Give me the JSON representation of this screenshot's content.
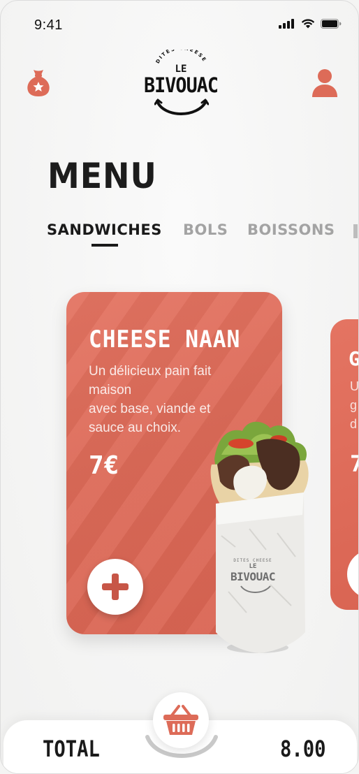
{
  "status_bar": {
    "time": "9:41"
  },
  "header": {
    "logo": {
      "tagline": "DITES CHEESE",
      "prefix": "LE",
      "name": "BIVOUAC"
    }
  },
  "page_title": "MENU",
  "tabs": [
    {
      "label": "SANDWICHES",
      "active": true
    },
    {
      "label": "BOLS",
      "active": false
    },
    {
      "label": "BOISSONS",
      "active": false
    }
  ],
  "products": [
    {
      "name": "CHEESE NAAN",
      "description_lines": [
        "Un délicieux pain fait",
        "maison",
        "avec base, viande et",
        "sauce au choix."
      ],
      "price": "7€",
      "image_brand": {
        "tagline": "DITES CHEESE",
        "prefix": "LE",
        "name": "BIVOUAC"
      }
    },
    {
      "name": "G",
      "description_lines": [
        "U",
        "g",
        "d"
      ],
      "price": "7"
    }
  ],
  "cart": {
    "total_label": "TOTAL",
    "total_value": "8.00"
  },
  "colors": {
    "accent": "#dd6b58",
    "text": "#1a1a1a",
    "muted": "#a3a3a3",
    "background": "#f4f4f3"
  },
  "icons": [
    "signal-icon",
    "wifi-icon",
    "battery-icon",
    "money-bag-icon",
    "user-icon",
    "plus-icon",
    "basket-icon"
  ]
}
